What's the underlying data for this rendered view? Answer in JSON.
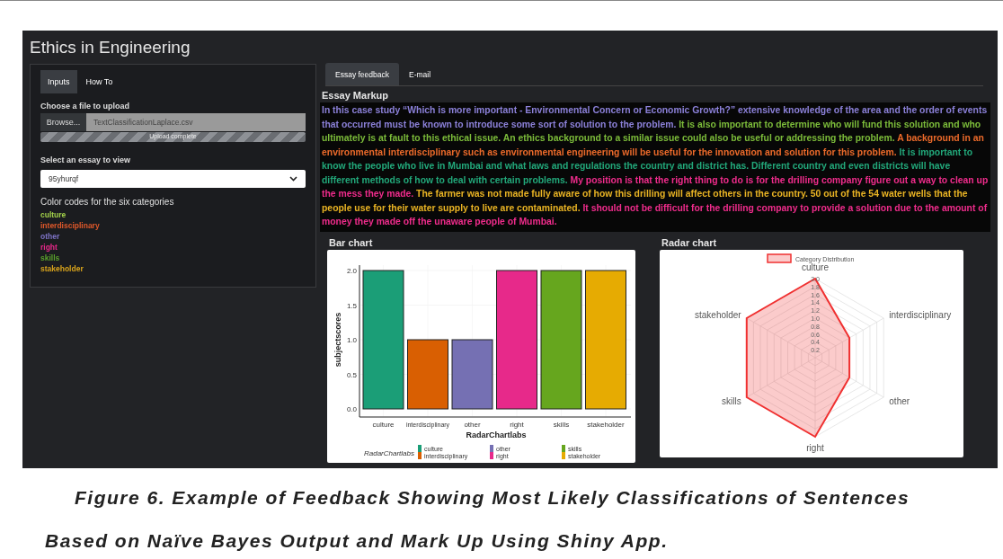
{
  "window": {
    "title": "Ethics in Engineering"
  },
  "sidebar": {
    "tabs": [
      {
        "label": "Inputs",
        "selected": true
      },
      {
        "label": "How To",
        "selected": false
      }
    ],
    "file_upload": {
      "label": "Choose a file to upload",
      "button": "Browse...",
      "value": "TextClassificationLaplace.csv",
      "progress_text": "Upload complete",
      "level": 1
    },
    "essay_select": {
      "label": "Select an essay to view",
      "value": "95yhurqf"
    },
    "color_codes": {
      "heading": "Color codes for the six categories",
      "items": [
        {
          "label": "culture",
          "color": "#a3d14a"
        },
        {
          "label": "interdisciplinary",
          "color": "#e0582a"
        },
        {
          "label": "other",
          "color": "#7c72c4"
        },
        {
          "label": "right",
          "color": "#e8288a"
        },
        {
          "label": "skills",
          "color": "#5aa02c"
        },
        {
          "label": "stakeholder",
          "color": "#d9a41c"
        }
      ]
    }
  },
  "main": {
    "tabs": [
      {
        "label": "Essay feedback",
        "selected": true
      },
      {
        "label": "E-mail",
        "selected": false
      }
    ],
    "essay_markup": {
      "heading": "Essay Markup",
      "segments": [
        {
          "text": "In this case study “Which is more important - Environmental Concern or Economic Growth?” extensive knowledge of the area and the order of events that occurred must be known to introduce some sort of solution to the problem.",
          "color": "#8b80d8"
        },
        {
          "text": "It is also important to determine who will fund this solution and who ultimately is at fault to this ethical issue. An ethics background to a similar issue could also be useful or addressing the problem.",
          "color": "#7cbc3a"
        },
        {
          "text": "A background in an environmental interdisciplinary such as environmental engineering will be useful for the innovation and solution for this problem.",
          "color": "#ec6a2a"
        },
        {
          "text": "It is important to know the people who live in Mumbai and what laws and regulations the country and district has. Different country and even districts will have different methods of how to deal with certain problems.",
          "color": "#22a87a"
        },
        {
          "text": "My position is that the right thing to do is for the drilling company figure out a way to clean up the mess they made.",
          "color": "#f02c8c"
        },
        {
          "text": "The farmer was not made fully aware of how this drilling will affect others in the country. 50 out of the 54 water wells that the people use for their water supply to live are contaminated.",
          "color": "#eab424"
        },
        {
          "text": "It should not be difficult for the drilling company to provide a solution due to the amount of money they made off the unaware people of Mumbai.",
          "color": "#f02c8c"
        }
      ]
    },
    "bar_chart": {
      "heading": "Bar chart",
      "chart_data": {
        "type": "bar",
        "xlabel": "RadarChartlabs",
        "ylabel": "subjectscores",
        "categories": [
          "culture",
          "interdisciplinary",
          "other",
          "right",
          "skills",
          "stakeholder"
        ],
        "series": [
          {
            "name": "RadarChartlabs",
            "values": [
              2,
              1,
              1,
              2,
              2,
              2
            ]
          }
        ],
        "colors": [
          "#1b9e77",
          "#d95f02",
          "#7570b3",
          "#e7298a",
          "#66a61e",
          "#e6ab02"
        ],
        "ylim": [
          0,
          2
        ],
        "grid": true,
        "yticks": [
          {
            "value": 0,
            "label": "0.0"
          },
          {
            "value": 0.5,
            "label": "0.5"
          },
          {
            "value": 1,
            "label": "1.0"
          },
          {
            "value": 1.5,
            "label": "1.5"
          },
          {
            "value": 2,
            "label": "2.0"
          }
        ]
      }
    },
    "radar_chart": {
      "heading": "Radar chart",
      "chart_data": {
        "type": "radar",
        "categories": [
          "culture",
          "interdisciplinary",
          "other",
          "right",
          "skills",
          "stakeholder"
        ],
        "series": [
          {
            "name": "Category Distribution",
            "color": "#f03030",
            "values": [
              2,
              1,
              1,
              2,
              2,
              2
            ]
          }
        ],
        "ylim": [
          0,
          2
        ],
        "yticks": [
          {
            "value": 0.2,
            "label": "0.2"
          },
          {
            "value": 0.4,
            "label": "0.4"
          },
          {
            "value": 0.6,
            "label": "0.6"
          },
          {
            "value": 0.8,
            "label": "0.8"
          },
          {
            "value": 1,
            "label": "1.0"
          },
          {
            "value": 1.2,
            "label": "1.2"
          },
          {
            "value": 1.4,
            "label": "1.4"
          },
          {
            "value": 1.6,
            "label": "1.6"
          },
          {
            "value": 1.8,
            "label": "1.8"
          },
          {
            "value": 2,
            "label": "2.0"
          }
        ]
      }
    }
  },
  "caption": "Figure 6. Example of Feedback Showing Most Likely Classifications of Sentences Based on Naïve Bayes Output and Mark Up Using Shiny App."
}
